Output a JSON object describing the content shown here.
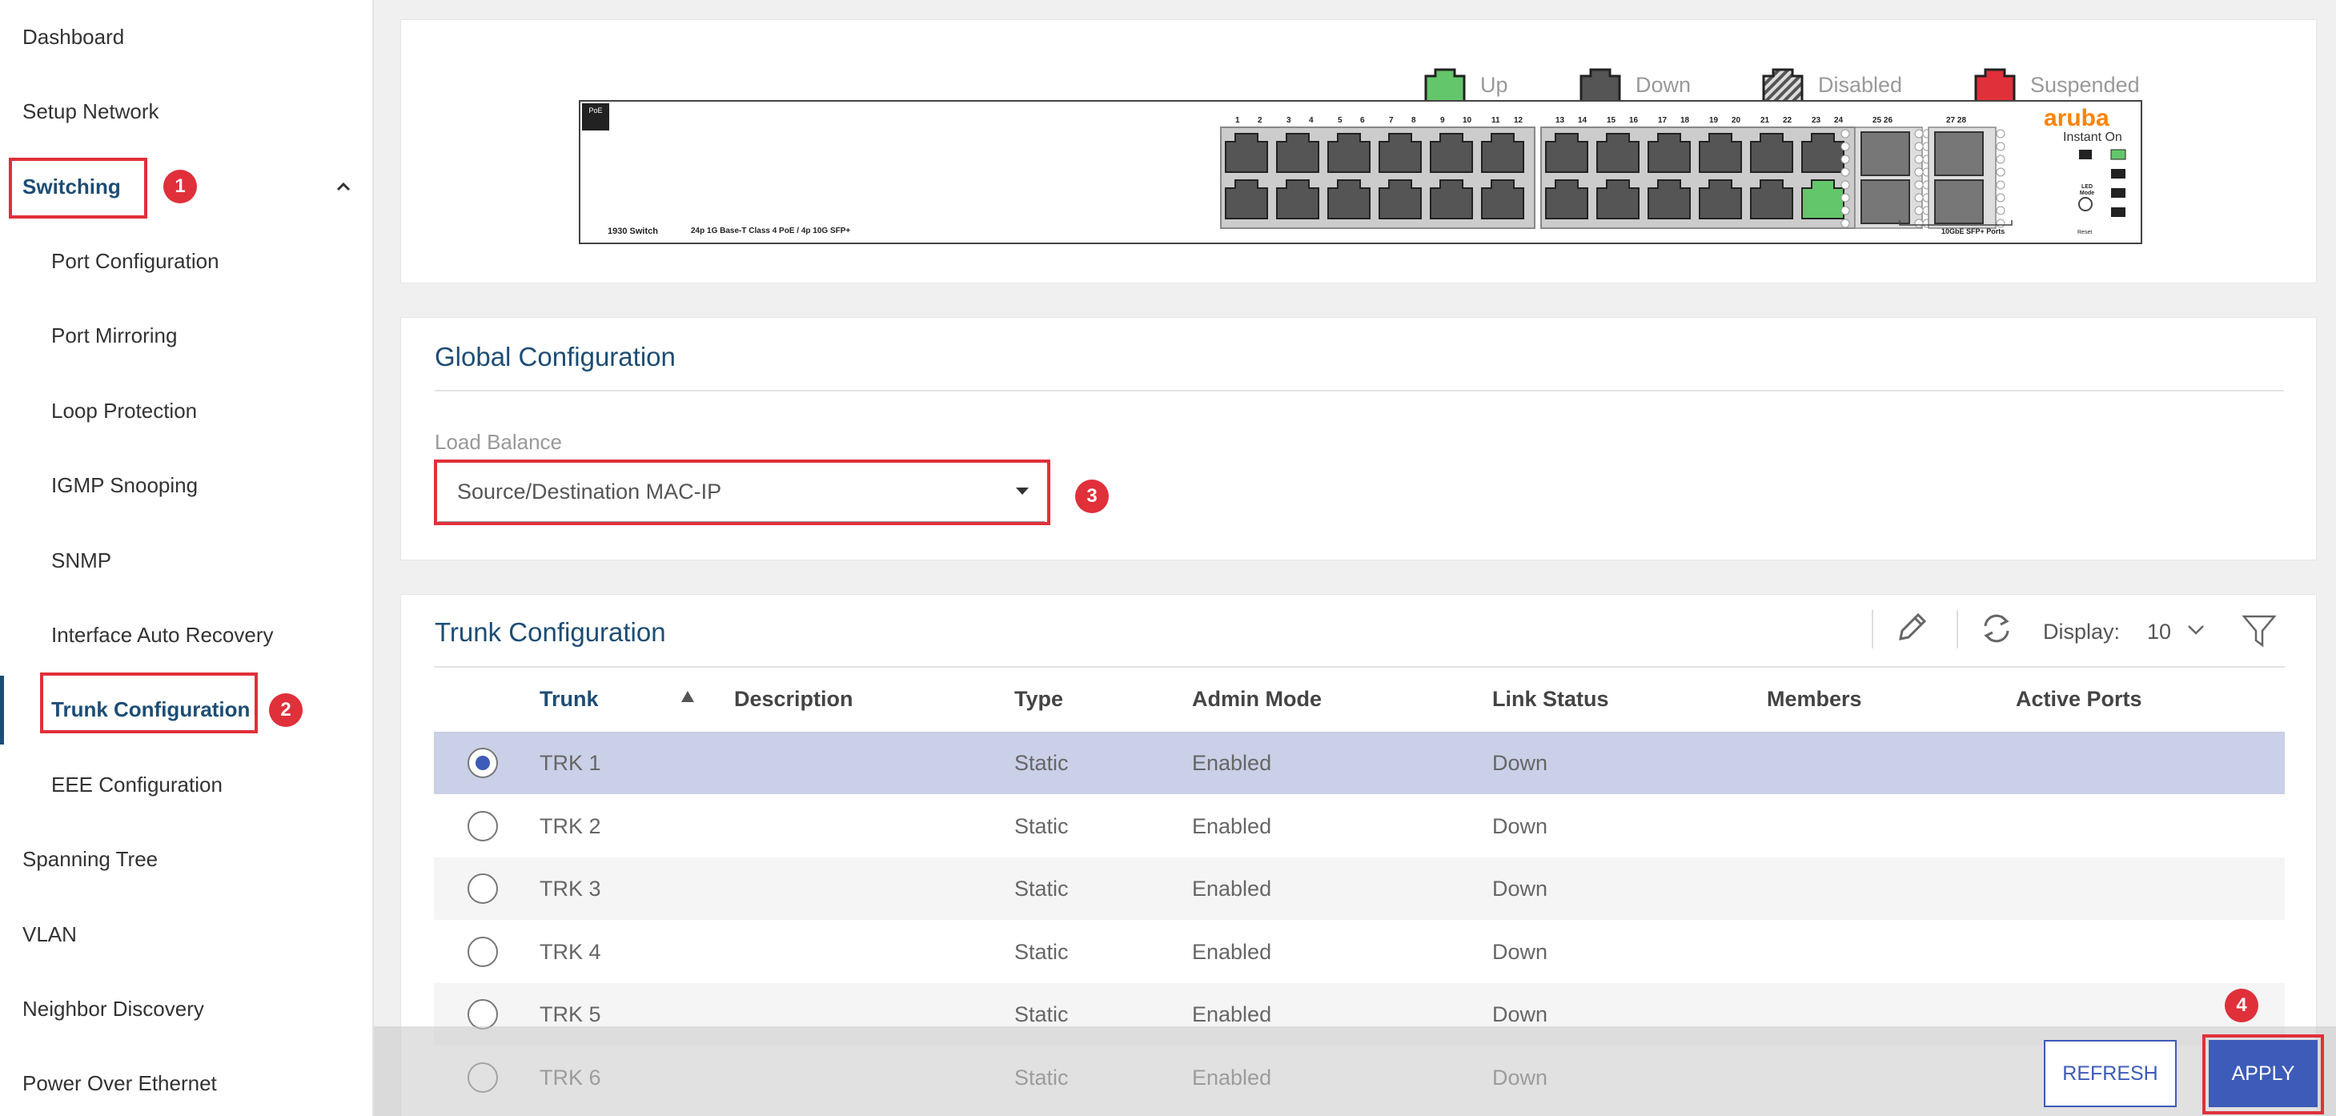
{
  "sidebar": {
    "items": [
      {
        "label": "Dashboard"
      },
      {
        "label": "Setup Network"
      },
      {
        "label": "Switching"
      },
      {
        "label": "Port Configuration"
      },
      {
        "label": "Port Mirroring"
      },
      {
        "label": "Loop Protection"
      },
      {
        "label": "IGMP Snooping"
      },
      {
        "label": "SNMP"
      },
      {
        "label": "Interface Auto Recovery"
      },
      {
        "label": "Trunk Configuration"
      },
      {
        "label": "EEE Configuration"
      },
      {
        "label": "Spanning Tree"
      },
      {
        "label": "VLAN"
      },
      {
        "label": "Neighbor Discovery"
      },
      {
        "label": "Power Over Ethernet"
      }
    ]
  },
  "badges": [
    "1",
    "2",
    "3",
    "4"
  ],
  "legend": {
    "up": "Up",
    "down": "Down",
    "disabled": "Disabled",
    "suspended": "Suspended"
  },
  "colors": {
    "up": "#63c66a",
    "down": "#555555",
    "suspended": "#e0303a",
    "accent": "#1d4d75",
    "selected_row": "#c9d0e7",
    "apply": "#3d5bb8"
  },
  "switch": {
    "model": "1930 Switch",
    "desc": "24p 1G Base-T Class 4 PoE / 4p 10G SFP+",
    "poe": "PoE",
    "brand": "aruba",
    "brand_sub": "Instant On",
    "sfp_label": "10GbE SFP+ Ports",
    "top_labels": [
      "1",
      "2",
      "3",
      "4",
      "5",
      "6",
      "7",
      "8",
      "9",
      "10",
      "11",
      "12",
      "13",
      "14",
      "15",
      "16",
      "17",
      "18",
      "19",
      "20",
      "21",
      "22",
      "23",
      "24"
    ],
    "sfp_labels": [
      "25",
      "26",
      "27",
      "28"
    ],
    "up_ports": [
      "24"
    ],
    "side_labels": [
      "LED Mode",
      "Reset"
    ]
  },
  "global": {
    "title": "Global Configuration",
    "load_label": "Load Balance",
    "load_value": "Source/Destination MAC-IP"
  },
  "trunk": {
    "title": "Trunk Configuration",
    "display_label": "Display:",
    "display_value": "10",
    "headers": [
      "Trunk",
      "Description",
      "Type",
      "Admin Mode",
      "Link Status",
      "Members",
      "Active Ports"
    ],
    "sort_icon": "sort-ascending-icon",
    "rows": [
      {
        "trunk": "TRK 1",
        "description": "",
        "type": "Static",
        "admin": "Enabled",
        "link": "Down",
        "selected": true
      },
      {
        "trunk": "TRK 2",
        "description": "",
        "type": "Static",
        "admin": "Enabled",
        "link": "Down",
        "selected": false
      },
      {
        "trunk": "TRK 3",
        "description": "",
        "type": "Static",
        "admin": "Enabled",
        "link": "Down",
        "selected": false
      },
      {
        "trunk": "TRK 4",
        "description": "",
        "type": "Static",
        "admin": "Enabled",
        "link": "Down",
        "selected": false
      },
      {
        "trunk": "TRK 5",
        "description": "",
        "type": "Static",
        "admin": "Enabled",
        "link": "Down",
        "selected": false
      },
      {
        "trunk": "TRK 6",
        "description": "",
        "type": "Static",
        "admin": "Enabled",
        "link": "Down",
        "selected": false
      }
    ]
  },
  "footer": {
    "refresh": "REFRESH",
    "apply": "APPLY"
  }
}
